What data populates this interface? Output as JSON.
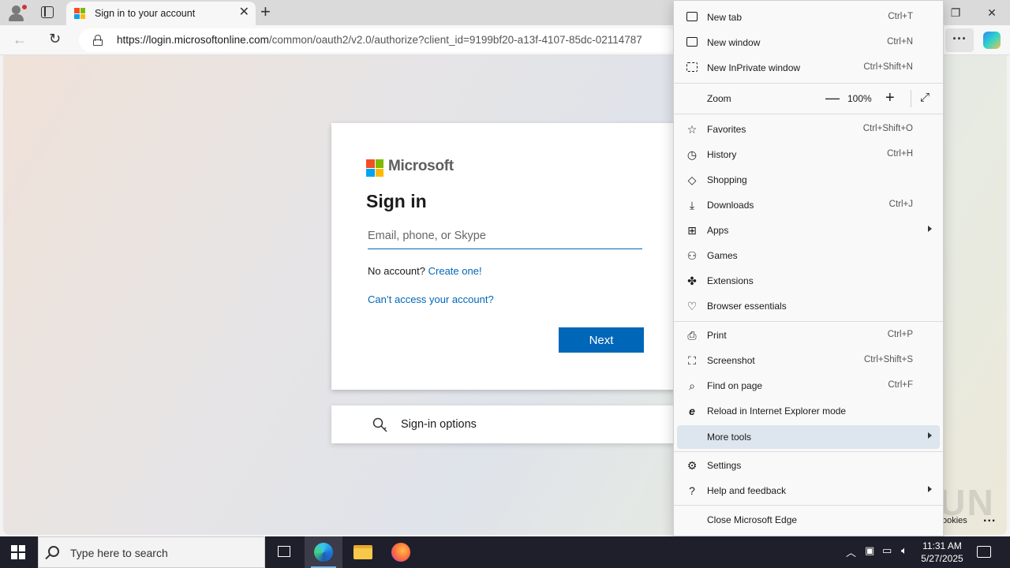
{
  "browser": {
    "tab_title": "Sign in to your account",
    "url_host": "https://login.microsoftonline.com",
    "url_rest": "/common/oauth2/v2.0/authorize?client_id=9199bf20-a13f-4107-85dc-02114787"
  },
  "page": {
    "brand": "Microsoft",
    "heading": "Sign in",
    "email_placeholder": "Email, phone, or Skype",
    "no_account": "No account?",
    "create_link": "Create one!",
    "cant_access": "Can’t access your account?",
    "next_button": "Next",
    "sign_in_options": "Sign-in options",
    "cookies_text": "ookies",
    "cookies_more": "..."
  },
  "menu": {
    "items": [
      {
        "label": "New tab",
        "shortcut": "Ctrl+T"
      },
      {
        "label": "New window",
        "shortcut": "Ctrl+N"
      },
      {
        "label": "New InPrivate window",
        "shortcut": "Ctrl+Shift+N"
      },
      {
        "label": "Zoom",
        "value": "100%"
      },
      {
        "label": "Favorites",
        "shortcut": "Ctrl+Shift+O"
      },
      {
        "label": "History",
        "shortcut": "Ctrl+H"
      },
      {
        "label": "Shopping",
        "shortcut": ""
      },
      {
        "label": "Downloads",
        "shortcut": "Ctrl+J"
      },
      {
        "label": "Apps",
        "shortcut": ""
      },
      {
        "label": "Games",
        "shortcut": ""
      },
      {
        "label": "Extensions",
        "shortcut": ""
      },
      {
        "label": "Browser essentials",
        "shortcut": ""
      },
      {
        "label": "Print",
        "shortcut": "Ctrl+P"
      },
      {
        "label": "Screenshot",
        "shortcut": "Ctrl+Shift+S"
      },
      {
        "label": "Find on page",
        "shortcut": "Ctrl+F"
      },
      {
        "label": "Reload in Internet Explorer mode",
        "shortcut": ""
      },
      {
        "label": "More tools",
        "shortcut": ""
      },
      {
        "label": "Settings",
        "shortcut": ""
      },
      {
        "label": "Help and feedback",
        "shortcut": ""
      },
      {
        "label": "Close Microsoft Edge",
        "shortcut": ""
      }
    ]
  },
  "taskbar": {
    "search_placeholder": "Type here to search",
    "time": "11:31 AM",
    "date": "5/27/2025"
  },
  "watermark": "ANY RUN",
  "colors": {
    "accent": "#0067b8",
    "menu_highlight": "#dde5ee",
    "taskbar": "#1f1f2b"
  }
}
